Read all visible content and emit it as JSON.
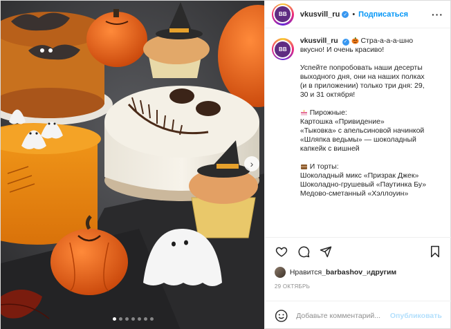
{
  "post": {
    "username": "vkusvill_ru",
    "avatar_text": "ВВ",
    "separator": "•",
    "follow_label": "Подписаться",
    "more_label": "···"
  },
  "caption": {
    "username": "vkusvill_ru",
    "lines_intro": [
      "Стра-а-а-а-шно",
      "вкусно! И очень красиво!"
    ],
    "lines_body": [
      "Успейте попробовать наши десерты",
      "выходного дня, они на наших полках",
      "(и в приложении) только три дня: 29,",
      "30 и 31 октября!"
    ],
    "cakes_heading": "Пирожные:",
    "cakes": [
      "Картошка «Привидение»",
      "«Тыковка» с апельсиновой начинкой",
      "«Шляпка ведьмы» — шоколадный",
      "капкейк с вишней"
    ],
    "tortes_heading": "И торты:",
    "tortes": [
      "Шоколадный микс «Призрак Джек»",
      "Шоколадно-грушевый «Паутинка Бу»",
      "Медово-сметанный «Хэллоуин»"
    ]
  },
  "likes": {
    "prefix": "Нравится ",
    "user": "_barbashov_",
    "middle": " и ",
    "others": "другим"
  },
  "date": "29 ОКТЯБРЬ",
  "comment": {
    "placeholder": "Добавьте комментарий...",
    "publish_label": "Опубликовать"
  },
  "carousel": {
    "total": 7,
    "active": 0
  },
  "colors": {
    "accent": "#0095f6",
    "verified": "#3897f0",
    "publish_disabled": "#b2dffc"
  },
  "icons": [
    "heart-icon",
    "comment-icon",
    "share-icon",
    "bookmark-icon",
    "smile-icon",
    "pumpkin-emoji",
    "cake-emoji",
    "cookie-emoji",
    "chevron-right-icon",
    "verified-icon"
  ]
}
